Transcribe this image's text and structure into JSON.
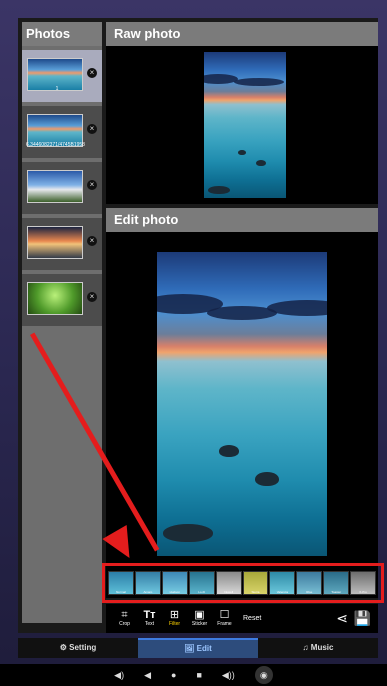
{
  "photos_panel": {
    "title": "Photos",
    "items": [
      {
        "caption": "1",
        "selected": true
      },
      {
        "caption": "6,3446082371/4745B1958",
        "selected": false
      },
      {
        "caption": "",
        "selected": false
      },
      {
        "caption": "",
        "selected": false
      },
      {
        "caption": "",
        "selected": false
      }
    ]
  },
  "raw_panel": {
    "title": "Raw photo"
  },
  "edit_panel": {
    "title": "Edit photo"
  },
  "filters": [
    {
      "label": "Normal"
    },
    {
      "label": "Amaro"
    },
    {
      "label": "Hudson"
    },
    {
      "label": "Lo-Fi"
    },
    {
      "label": "Inkwell"
    },
    {
      "label": "Sierra"
    },
    {
      "label": "Valencia"
    },
    {
      "label": "Rise"
    },
    {
      "label": "Toaster"
    },
    {
      "label": "X-Pro"
    }
  ],
  "toolbar": {
    "crop": "Crop",
    "text": "Text",
    "filter": "Filter",
    "sticker": "Sticker",
    "frame": "Frame",
    "reset": "Reset"
  },
  "tabs": {
    "setting": "Setting",
    "edit": "Edit",
    "music": "Music"
  },
  "colors": {
    "highlight": "#e41d1d",
    "active_tab": "#2d4c7c",
    "active_filter": "#ffd400"
  }
}
